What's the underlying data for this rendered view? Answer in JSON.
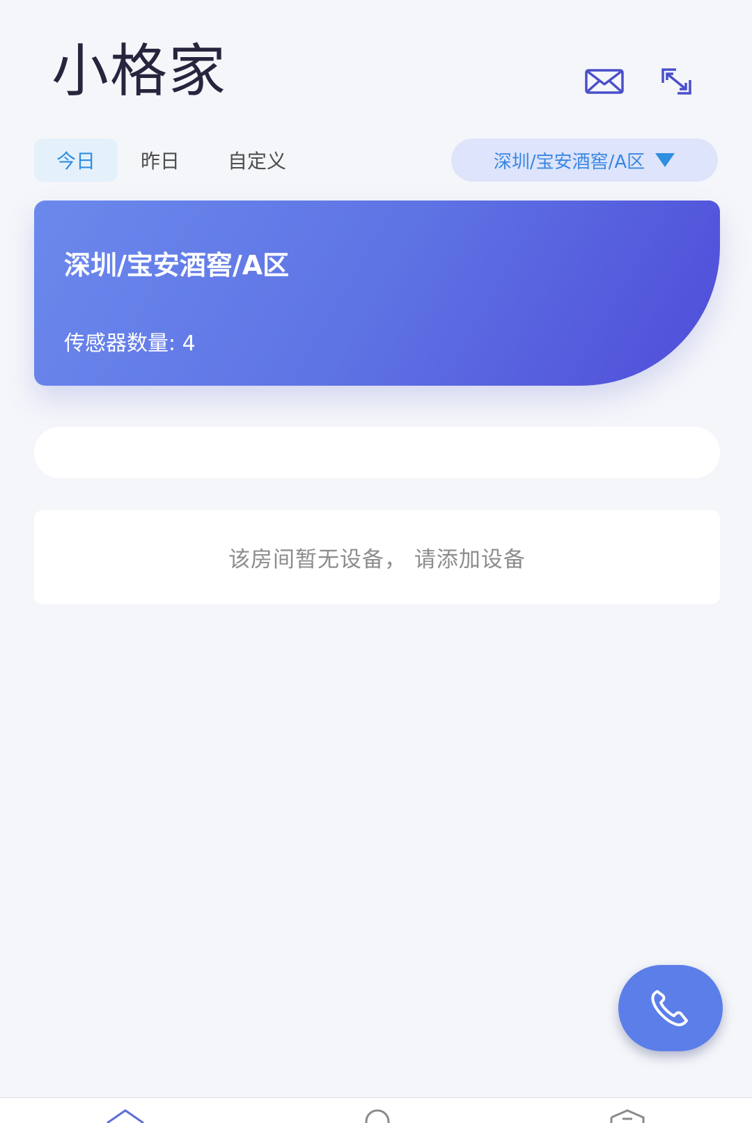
{
  "header": {
    "title": "小格家",
    "icons": [
      "mail-icon",
      "expand-icon"
    ]
  },
  "tabs": [
    {
      "label": "今日",
      "active": true
    },
    {
      "label": "昨日",
      "active": false
    },
    {
      "label": "自定义",
      "active": false
    }
  ],
  "location_select": {
    "value": "深圳/宝安酒窖/A区",
    "icon": "triangle-down-icon"
  },
  "banner": {
    "title": "深圳/宝安酒窖/A区",
    "sensor_label": "传感器数量:",
    "sensor_count": "4"
  },
  "empty_notice": {
    "text": "该房间暂无设备， 请添加设备"
  },
  "fab": {
    "icon": "phone-icon"
  },
  "bottom_nav": {
    "items": [
      "home-icon",
      "profile-icon",
      "shield-icon"
    ]
  },
  "colors": {
    "accent": "#2f8ee0",
    "banner_start": "#6b89ec",
    "banner_end": "#4f4dd9",
    "fab": "#5b7ee9",
    "title": "#25263d"
  }
}
